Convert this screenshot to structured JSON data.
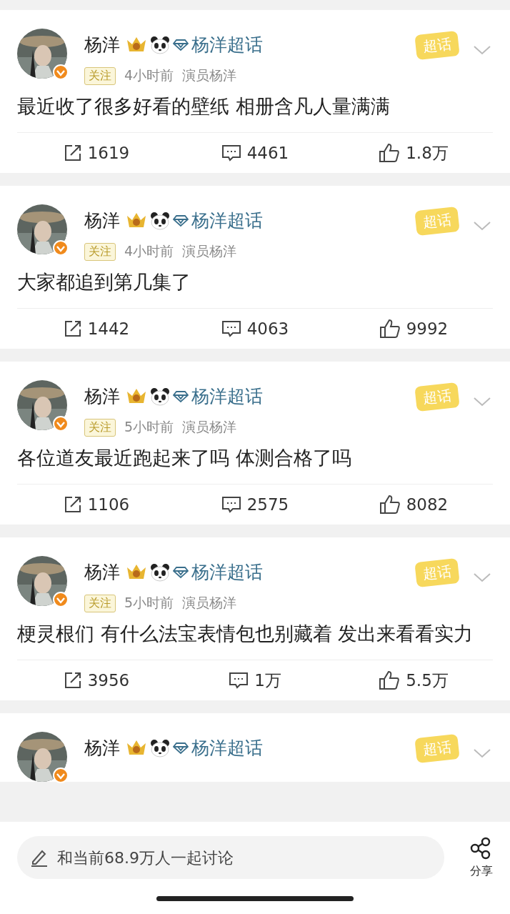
{
  "posts": [
    {
      "name": "杨洋",
      "topic": "杨洋超话",
      "sticker": "超话",
      "follow": "关注",
      "time": "4小时前",
      "source": "演员杨洋",
      "text": "最近收了很多好看的壁纸 相册含凡人量满满",
      "reposts": "1619",
      "comments": "4461",
      "likes": "1.8万"
    },
    {
      "name": "杨洋",
      "topic": "杨洋超话",
      "sticker": "超话",
      "follow": "关注",
      "time": "4小时前",
      "source": "演员杨洋",
      "text": "大家都追到第几集了",
      "reposts": "1442",
      "comments": "4063",
      "likes": "9992"
    },
    {
      "name": "杨洋",
      "topic": "杨洋超话",
      "sticker": "超话",
      "follow": "关注",
      "time": "5小时前",
      "source": "演员杨洋",
      "text": "各位道友最近跑起来了吗 体测合格了吗",
      "reposts": "1106",
      "comments": "2575",
      "likes": "8082"
    },
    {
      "name": "杨洋",
      "topic": "杨洋超话",
      "sticker": "超话",
      "follow": "关注",
      "time": "5小时前",
      "source": "演员杨洋",
      "text": "梗灵根们 有什么法宝表情包也别藏着 发出来看看实力",
      "reposts": "3956",
      "comments": "1万",
      "likes": "5.5万"
    },
    {
      "name": "杨洋",
      "topic": "杨洋超话",
      "sticker": "超话"
    }
  ],
  "composer": {
    "placeholder": "和当前68.9万人一起讨论"
  },
  "share": {
    "label": "分享"
  }
}
